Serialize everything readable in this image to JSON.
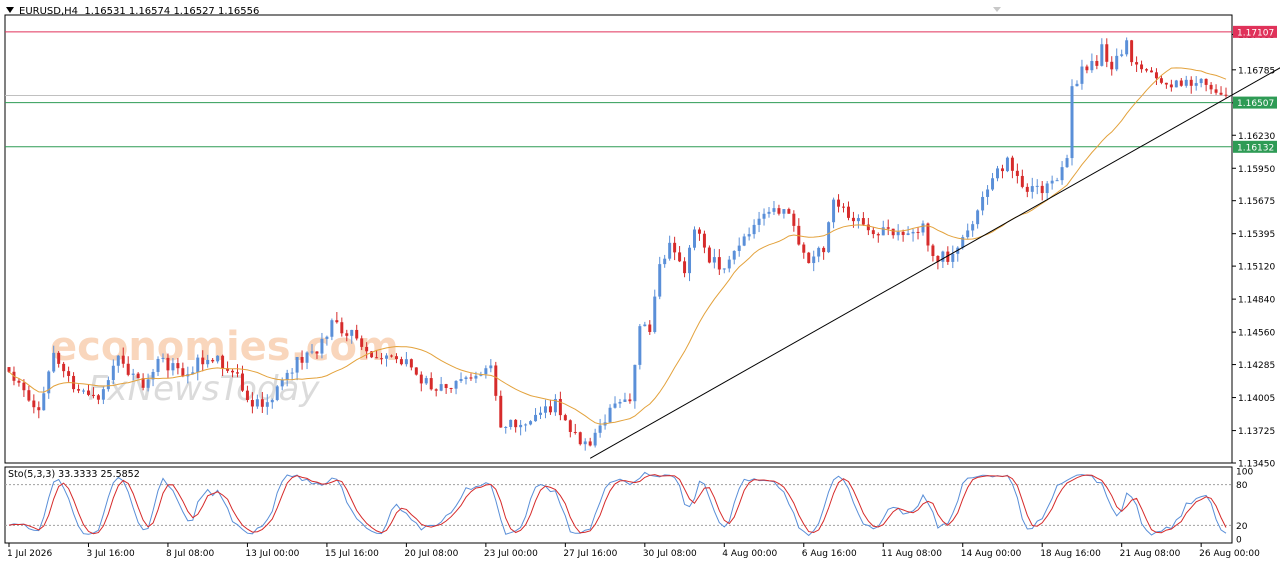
{
  "header": {
    "symbol": "EURUSD,H4",
    "ohlc": "1.16531 1.16574 1.16527 1.16556"
  },
  "stochastic": {
    "label": "Sto(5,3,3) 33.3333 25.5852",
    "levels": [
      "100",
      "80",
      "20",
      "0"
    ]
  },
  "watermark": {
    "brand": "economies.com",
    "sub": "FxNewsToday"
  },
  "chart_data": {
    "type": "candlestick",
    "ylim": [
      1.1345,
      1.1725
    ],
    "price_ticks": [
      "1.17085",
      "1.16785",
      "1.16505",
      "1.16230",
      "1.15950",
      "1.15675",
      "1.15395",
      "1.15120",
      "1.14840",
      "1.14560",
      "1.14285",
      "1.14005",
      "1.13725",
      "1.13450"
    ],
    "price_tick_values": [
      1.17085,
      1.16785,
      1.16505,
      1.1623,
      1.1595,
      1.15675,
      1.15395,
      1.1512,
      1.1484,
      1.1456,
      1.14285,
      1.14005,
      1.13725,
      1.1345
    ],
    "x_labels": [
      "1 Jul 2026",
      "3 Jul 16:00",
      "8 Jul 08:00",
      "13 Jul 00:00",
      "15 Jul 16:00",
      "20 Jul 08:00",
      "23 Jul 00:00",
      "27 Jul 16:00",
      "30 Jul 08:00",
      "4 Aug 00:00",
      "6 Aug 16:00",
      "11 Aug 08:00",
      "14 Aug 00:00",
      "18 Aug 16:00",
      "21 Aug 08:00",
      "26 Aug 00:00"
    ],
    "x_label_index": [
      0,
      16,
      32,
      48,
      64,
      80,
      96,
      112,
      128,
      144,
      160,
      176,
      192,
      208,
      224,
      240
    ],
    "bar_count": 246,
    "horizontal_lines": [
      {
        "value": 1.17107,
        "label": "1.17107",
        "color": "#e0325a"
      },
      {
        "value": 1.16507,
        "label": "1.16507",
        "color": "#2e9b55"
      },
      {
        "value": 1.16132,
        "label": "1.16132",
        "color": "#2e9b55"
      }
    ],
    "trendline": {
      "start": [
        117,
        1.1349
      ],
      "end": [
        260,
        1.169
      ],
      "color": "#000000"
    },
    "ma_color": "#e3a23c",
    "bull_color": "#5a8fd8",
    "bear_color": "#d62b2b",
    "anchors": [
      [
        0,
        1.1422
      ],
      [
        6,
        1.1388
      ],
      [
        9,
        1.144
      ],
      [
        13,
        1.141
      ],
      [
        18,
        1.1395
      ],
      [
        22,
        1.1433
      ],
      [
        27,
        1.1407
      ],
      [
        30,
        1.1433
      ],
      [
        35,
        1.142
      ],
      [
        40,
        1.1437
      ],
      [
        45,
        1.1423
      ],
      [
        49,
        1.1395
      ],
      [
        53,
        1.14
      ],
      [
        58,
        1.143
      ],
      [
        62,
        1.144
      ],
      [
        65,
        1.1462
      ],
      [
        69,
        1.1455
      ],
      [
        73,
        1.1438
      ],
      [
        77,
        1.1438
      ],
      [
        81,
        1.1425
      ],
      [
        85,
        1.1408
      ],
      [
        89,
        1.1413
      ],
      [
        94,
        1.1423
      ],
      [
        97,
        1.1428
      ],
      [
        99,
        1.1375
      ],
      [
        103,
        1.138
      ],
      [
        106,
        1.1385
      ],
      [
        110,
        1.1395
      ],
      [
        113,
        1.1375
      ],
      [
        117,
        1.1355
      ],
      [
        119,
        1.138
      ],
      [
        122,
        1.1392
      ],
      [
        125,
        1.14
      ],
      [
        127,
        1.1465
      ],
      [
        129,
        1.1455
      ],
      [
        131,
        1.151
      ],
      [
        133,
        1.153
      ],
      [
        136,
        1.1505
      ],
      [
        138,
        1.1545
      ],
      [
        140,
        1.1525
      ],
      [
        143,
        1.151
      ],
      [
        146,
        1.152
      ],
      [
        150,
        1.1545
      ],
      [
        154,
        1.156
      ],
      [
        157,
        1.1555
      ],
      [
        161,
        1.1515
      ],
      [
        164,
        1.1528
      ],
      [
        166,
        1.157
      ],
      [
        169,
        1.1555
      ],
      [
        173,
        1.1545
      ],
      [
        177,
        1.154
      ],
      [
        181,
        1.1535
      ],
      [
        184,
        1.1545
      ],
      [
        186,
        1.152
      ],
      [
        189,
        1.152
      ],
      [
        192,
        1.1535
      ],
      [
        195,
        1.156
      ],
      [
        198,
        1.1585
      ],
      [
        201,
        1.16
      ],
      [
        204,
        1.1578
      ],
      [
        208,
        1.1576
      ],
      [
        211,
        1.1585
      ],
      [
        213,
        1.1605
      ],
      [
        214,
        1.166
      ],
      [
        216,
        1.168
      ],
      [
        219,
        1.1685
      ],
      [
        220,
        1.17
      ],
      [
        222,
        1.168
      ],
      [
        225,
        1.17
      ],
      [
        227,
        1.168
      ],
      [
        230,
        1.1673
      ],
      [
        233,
        1.1665
      ],
      [
        236,
        1.1668
      ],
      [
        239,
        1.167
      ],
      [
        242,
        1.1665
      ],
      [
        244,
        1.1655
      ],
      [
        246,
        1.1655
      ]
    ],
    "stochastic_series": {
      "range": [
        0,
        100
      ],
      "main_color": "#d62b2b",
      "signal_color": "#5a8fd8"
    }
  }
}
